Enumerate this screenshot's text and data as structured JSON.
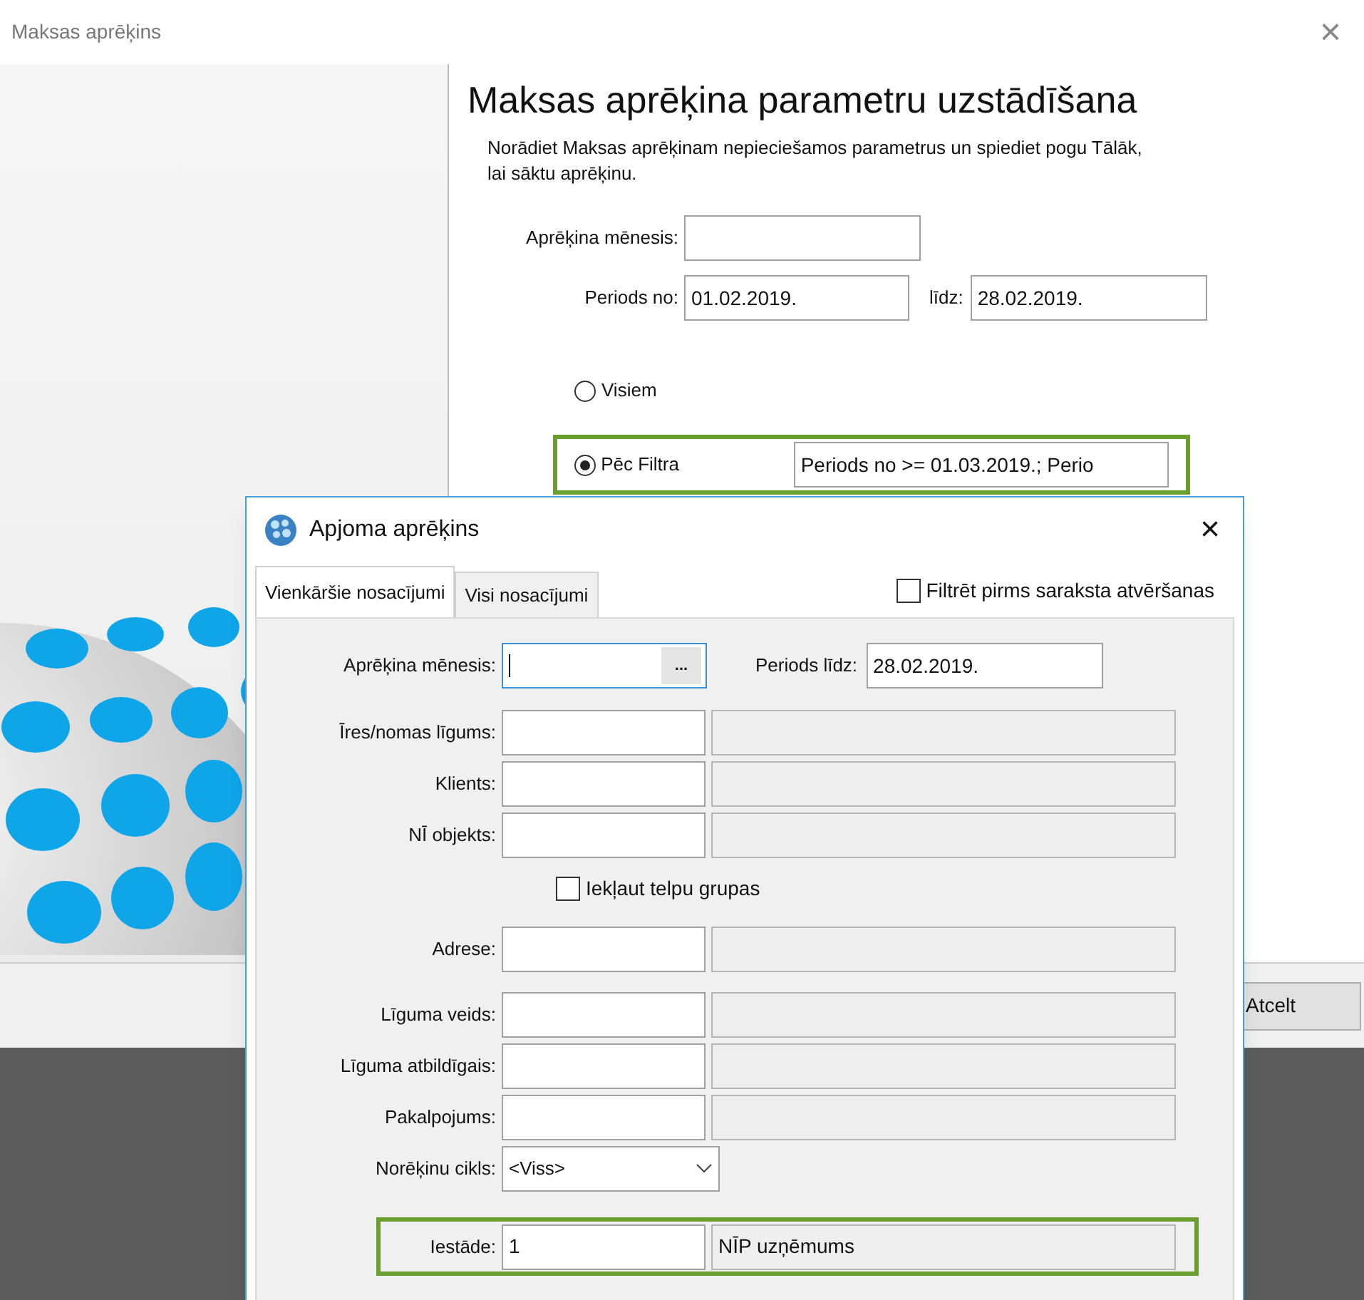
{
  "window": {
    "title": "Maksas aprēķins",
    "close": "×"
  },
  "wizard": {
    "heading": "Maksas aprēķina parametru uzstādīšana",
    "description": "Norādiet Maksas aprēķinam nepieciešamos parametrus un spiediet pogu Tālāk, lai sāktu aprēķinu.",
    "month": {
      "label": "Aprēķina mēnesis:"
    },
    "period_from": {
      "label": "Periods no:",
      "value": "01.02.2019."
    },
    "period_to": {
      "label": "līdz:",
      "value": "28.02.2019."
    },
    "radios": [
      {
        "label": "Visiem",
        "selected": false
      },
      {
        "label": "Pēc Filtra",
        "selected": true,
        "highlighted": true,
        "value": "Periods no >= 01.03.2019.; Perio"
      }
    ]
  },
  "buttons": [
    {
      "label": "Atcelt"
    }
  ],
  "dialog": {
    "title": "Apjoma aprēķins",
    "close": "×",
    "tabs": [
      {
        "label": "Vienkāršie nosacījumi",
        "selected": true
      },
      {
        "label": "Visi nosacījumi",
        "selected": false
      }
    ],
    "filter_before_open": {
      "label": "Filtrēt pirms saraksta atvēršanas",
      "checked": false
    },
    "month": {
      "label": "Aprēķina mēnesis:",
      "button": "..."
    },
    "period_to": {
      "label": "Periods līdz:",
      "value": "28.02.2019."
    },
    "rows": [
      {
        "kind": "lookup",
        "label": "Īres/nomas līgums:"
      },
      {
        "kind": "lookup",
        "label": "Klients:"
      },
      {
        "kind": "lookup",
        "label": "NĪ objekts:"
      },
      {
        "kind": "checkbox",
        "label": "Iekļaut telpu grupas",
        "checked": false
      },
      {
        "kind": "lookup",
        "label": "Adrese:"
      },
      {
        "kind": "lookup",
        "label": "Līguma veids:"
      },
      {
        "kind": "lookup",
        "label": "Līguma atbildīgais:"
      },
      {
        "kind": "lookup",
        "label": "Pakalpojums:"
      },
      {
        "kind": "select",
        "label": "Norēķinu cikls:",
        "value": "<Viss>"
      },
      {
        "kind": "lookup",
        "label": "Iestāde:",
        "code": "1",
        "name": "NĪP uzņēmums",
        "highlighted": true
      }
    ]
  }
}
